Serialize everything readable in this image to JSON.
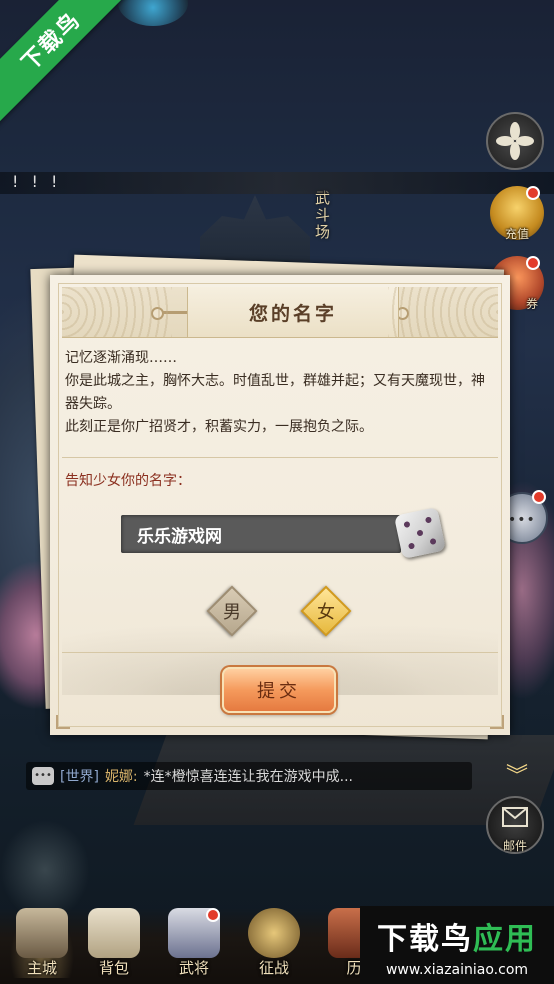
{
  "watermark": {
    "corner_text": "下载鸟",
    "brand_main": "下载鸟",
    "brand_accent": "应用",
    "url": "www.xiazainiao.com"
  },
  "background": {
    "banner_text": "! ! !",
    "arena_label": "武斗场"
  },
  "side_icons": {
    "charge_label": "充值",
    "coupon_label": "券",
    "mail_label": "邮件"
  },
  "dialog": {
    "title": "您的名字",
    "story_lines": [
      "记忆逐渐涌现……",
      "你是此城之主，胸怀大志。时值乱世，群雄并起；又有天魔现世，神器失踪。",
      "此刻正是你广招贤才，积蓄实力，一展抱负之际。"
    ],
    "prompt": "告知少女你的名字：",
    "name_value": "乐乐游戏网",
    "gender_male": "男",
    "gender_female": "女",
    "selected_gender": "女",
    "submit_label": "提交"
  },
  "chat": {
    "channel": "[世界]",
    "sender": "妮娜:",
    "message": "*连*橙惊喜连连让我在游戏中成..."
  },
  "bottom_nav": [
    {
      "label": "主城",
      "active": true
    },
    {
      "label": "背包",
      "active": false
    },
    {
      "label": "武将",
      "active": false
    },
    {
      "label": "征战",
      "active": false
    },
    {
      "label": "历",
      "active": false
    }
  ],
  "colors": {
    "watermark_green": "#27a94b",
    "dialog_paper": "#f6f0e4",
    "prompt_red": "#8b3020",
    "submit_orange": "#f59a5c",
    "female_gold": "#e7b93e"
  }
}
